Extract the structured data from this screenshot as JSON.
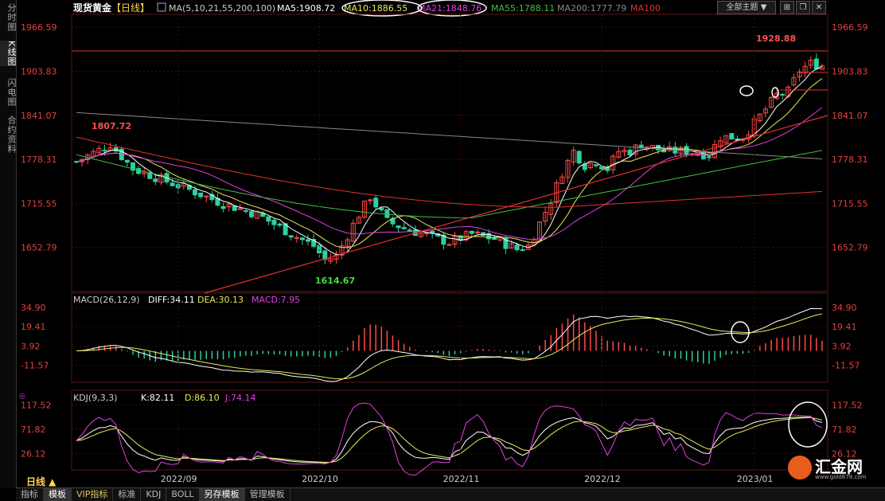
{
  "sidebar": {
    "tabs": [
      {
        "label": "分时图",
        "active": false
      },
      {
        "label": "K线图",
        "active": true
      },
      {
        "label": "闪电图",
        "active": false
      },
      {
        "label": "合约资料",
        "active": false
      }
    ]
  },
  "header": {
    "instrument": "现货黄金",
    "period": "【日线】",
    "ma_prefix": "MA(5,10,21,55,200,100)",
    "ma5": "MA5:1908.72",
    "ma10": "MA10:1886.55",
    "ma21": "MA21:1848.76",
    "ma55": "MA55:1788.11",
    "ma200": "MA200:1777.79",
    "ma100": "MA100",
    "theme_button": "全部主题",
    "theme_arrow": "▼"
  },
  "colors": {
    "up": "#ff4a4a",
    "down": "#2dd0a0",
    "ma5": "#ffffff",
    "ma10": "#e8e85a",
    "ma21": "#e040e0",
    "ma55": "#40c040",
    "ma200": "#888888",
    "ma100": "#e03030",
    "axis_text": "#e04040",
    "grid": "#3a1010"
  },
  "chart_data": [
    {
      "type": "candlestick",
      "title": "现货黄金【日线】",
      "y_ticks": [
        "1966.59",
        "1903.83",
        "1841.07",
        "1778.31",
        "1715.55",
        "1652.79"
      ],
      "ylim": [
        1590,
        1985
      ],
      "x_ticks": [
        "2022/09",
        "2022/10",
        "2022/11",
        "2022/12",
        "2023/01"
      ],
      "annotations": {
        "high": "1928.88",
        "low": "1614.67",
        "earlier_high": "1807.72"
      },
      "series": [
        {
          "name": "MA5",
          "last": 1908.72
        },
        {
          "name": "MA10",
          "last": 1886.55
        },
        {
          "name": "MA21",
          "last": 1848.76
        },
        {
          "name": "MA55",
          "last": 1788.11
        },
        {
          "name": "MA200",
          "last": 1777.79
        }
      ]
    },
    {
      "type": "line",
      "title": "MACD(26,12,9)",
      "labels": {
        "diff": "DIFF:34.11",
        "dea": "DEA:30.13",
        "macd": "MACD:7.95"
      },
      "y_ticks": [
        "34.90",
        "19.41",
        "3.92",
        "-11.57"
      ],
      "ylim": [
        -24,
        40
      ]
    },
    {
      "type": "line",
      "title": "KDJ(9,3,3)",
      "labels": {
        "k": "K:82.11",
        "d": "D:86.10",
        "j": "J:74.14"
      },
      "y_ticks": [
        "117.52",
        "71.82",
        "26.12"
      ],
      "ylim": [
        -2,
        130
      ]
    }
  ],
  "bottom_tabs": [
    {
      "label": "指标",
      "active": false,
      "vip": false
    },
    {
      "label": "模板",
      "active": true,
      "vip": false
    },
    {
      "label": "VIP指标",
      "active": false,
      "vip": true
    },
    {
      "label": "标准",
      "active": false,
      "vip": false
    },
    {
      "label": "KDJ",
      "active": false,
      "vip": false
    },
    {
      "label": "BOLL",
      "active": false,
      "vip": false
    },
    {
      "label": "另存模板",
      "active": true,
      "vip": false
    },
    {
      "label": "管理模板",
      "active": false,
      "vip": false
    }
  ],
  "period_selector": "日线 ▲",
  "logo": {
    "text": "汇金网",
    "url": "www.gold678.com"
  }
}
